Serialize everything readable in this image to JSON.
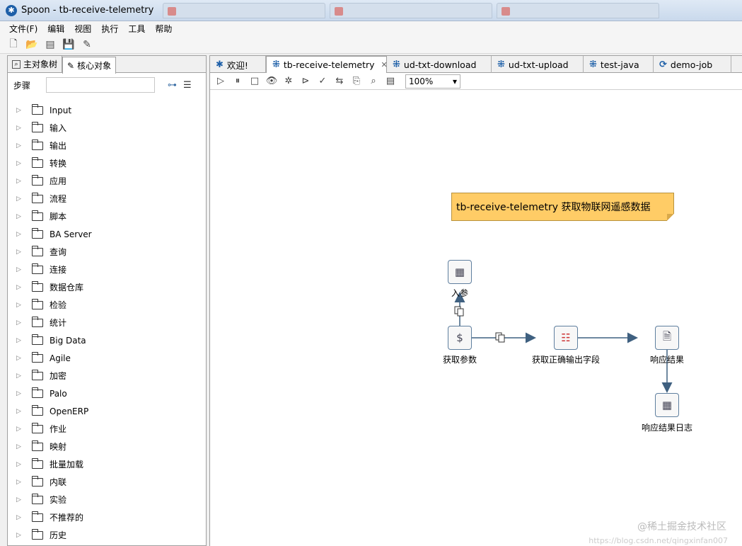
{
  "window": {
    "title": "Spoon - tb-receive-telemetry"
  },
  "menu": [
    "文件(F)",
    "编辑",
    "视图",
    "执行",
    "工具",
    "帮助"
  ],
  "left_panel": {
    "tabs": [
      {
        "label": "主对象树",
        "icon": "tree-icon"
      },
      {
        "label": "核心对象",
        "icon": "pencil-icon"
      }
    ],
    "steps_label": "步骤",
    "search_placeholder": "",
    "categories": [
      "Input",
      "输入",
      "输出",
      "转换",
      "应用",
      "流程",
      "脚本",
      "BA Server",
      "查询",
      "连接",
      "数据仓库",
      "检验",
      "统计",
      "Big Data",
      "Agile",
      "加密",
      "Palo",
      "OpenERP",
      "作业",
      "映射",
      "批量加载",
      "内联",
      "实验",
      "不推荐的",
      "历史"
    ]
  },
  "doc_tabs": [
    {
      "label": "欢迎!",
      "icon": "spoon-icon"
    },
    {
      "label": "tb-receive-telemetry",
      "icon": "transformation-icon",
      "active": true,
      "closable": true
    },
    {
      "label": "ud-txt-download",
      "icon": "transformation-icon"
    },
    {
      "label": "ud-txt-upload",
      "icon": "transformation-icon"
    },
    {
      "label": "test-java",
      "icon": "transformation-icon"
    },
    {
      "label": "demo-job",
      "icon": "job-icon"
    }
  ],
  "zoom": "100%",
  "canvas": {
    "note": "tb-receive-telemetry  获取物联网遥感数据",
    "steps": {
      "get_params": "获取参数",
      "in_params": "入参",
      "get_fields": "获取正确输出字段",
      "respond": "响应结果",
      "respond_log": "响应结果日志"
    }
  },
  "watermark": {
    "site": "@稀土掘金技术社区",
    "url": "https://blog.csdn.net/qingxinfan007"
  }
}
